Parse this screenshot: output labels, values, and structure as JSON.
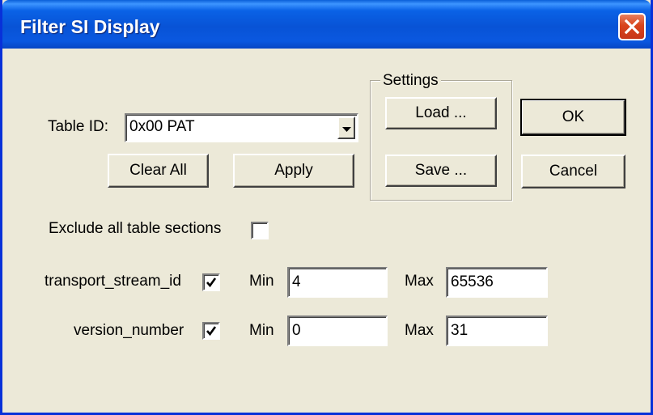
{
  "window": {
    "title": "Filter SI Display"
  },
  "table_id": {
    "label": "Table ID:",
    "value": "0x00 PAT"
  },
  "settings": {
    "group_label": "Settings",
    "load_label": "Load ...",
    "save_label": "Save ..."
  },
  "buttons": {
    "ok": "OK",
    "cancel": "Cancel",
    "clear_all": "Clear All",
    "apply": "Apply"
  },
  "exclude": {
    "label": "Exclude all table sections",
    "checked": false
  },
  "filters": [
    {
      "name": "transport_stream_id",
      "checked": true,
      "min_label": "Min",
      "min": "4",
      "max_label": "Max",
      "max": "65536"
    },
    {
      "name": "version_number",
      "checked": true,
      "min_label": "Min",
      "min": "0",
      "max_label": "Max",
      "max": "31"
    }
  ],
  "icons": {
    "close": "close-icon",
    "dropdown": "chevron-down-icon",
    "check": "checkmark-icon"
  }
}
